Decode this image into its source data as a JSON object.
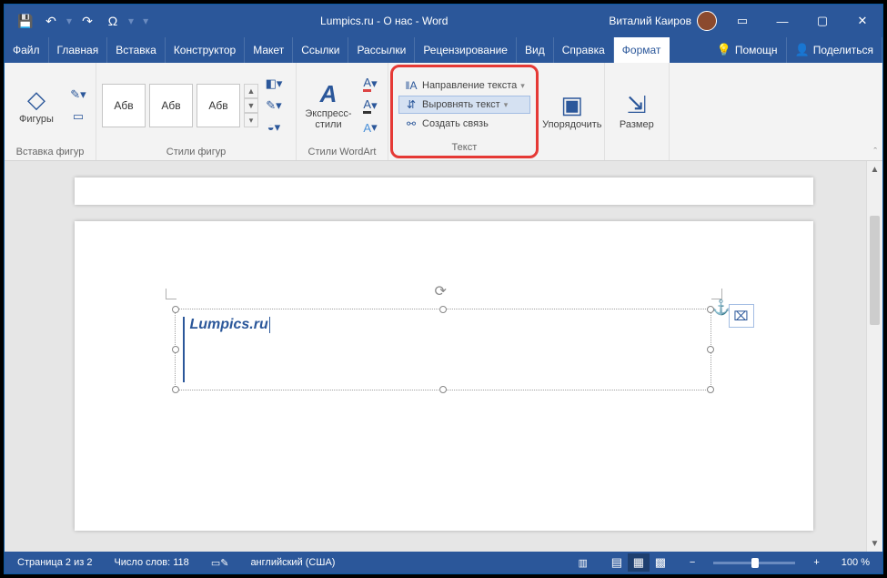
{
  "title": "Lumpics.ru - О нас  -  Word",
  "user": "Виталий Каиров",
  "qat": {
    "save": "💾",
    "undo": "↶",
    "redo": "↷",
    "sym": "Ω"
  },
  "tabs": [
    "Файл",
    "Главная",
    "Вставка",
    "Конструктор",
    "Макет",
    "Ссылки",
    "Рассылки",
    "Рецензирование",
    "Вид",
    "Справка",
    "Формат"
  ],
  "active_tab": "Формат",
  "help_tab": "Помощн",
  "share": "Поделиться",
  "ribbon": {
    "g_shapes_big": "Фигуры",
    "g_shapes": "Вставка фигур",
    "style_label": "Абв",
    "g_styles": "Стили фигур",
    "g_wordart_big": "Экспресс-стили",
    "g_wordart": "Стили WordArt",
    "text": {
      "direction": "Направление текста",
      "align": "Выровнять текст",
      "link": "Создать связь",
      "label": "Текст"
    },
    "g_arrange": "Упорядочить",
    "g_size": "Размер"
  },
  "textbox_content": "Lumpics.ru",
  "status": {
    "page": "Страница 2 из 2",
    "words": "Число слов: 118",
    "lang": "английский (США)",
    "zoom": "100 %"
  }
}
